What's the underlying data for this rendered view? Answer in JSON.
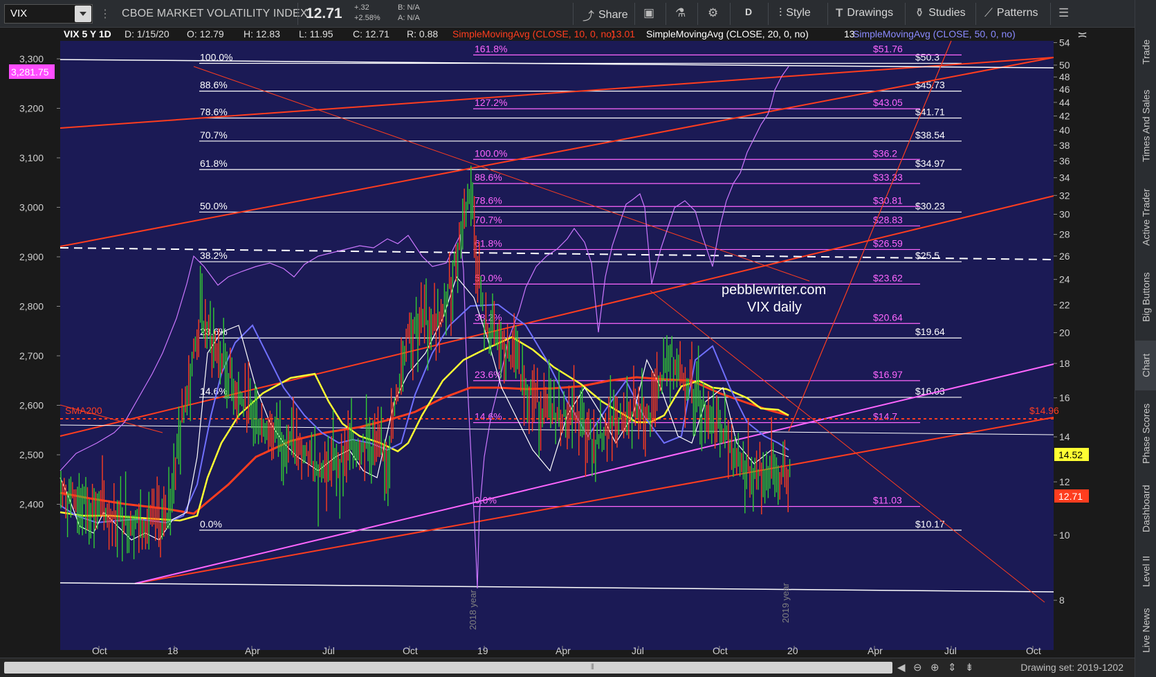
{
  "toolbar": {
    "symbol": "VIX",
    "description": "CBOE MARKET VOLATILITY INDEX",
    "last": "12.71",
    "change": "+.32",
    "change_pct": "+2.58%",
    "bid": "B: N/A",
    "ask": "A: N/A",
    "share_label": "Share",
    "aggregation_label": "D",
    "style_label": "Style",
    "drawings_label": "Drawings",
    "studies_label": "Studies",
    "patterns_label": "Patterns"
  },
  "right_sidebar": {
    "tabs": [
      "Trade",
      "Times And Sales",
      "Active Trader",
      "Big Buttons",
      "Chart",
      "Phase Scores",
      "Dashboard",
      "Level II",
      "Live News"
    ],
    "active": "Chart"
  },
  "chart_header": {
    "title": "VIX 5 Y 1D",
    "date": "D: 1/15/20",
    "open": "O: 12.79",
    "high": "H: 12.83",
    "low": "L: 11.95",
    "close": "C: 12.71",
    "range": "R: 0.88",
    "sma10_label": "SimpleMovingAvg (CLOSE, 10, 0, no)",
    "sma10_value": "13.01",
    "sma20_label": "SimpleMovingAvg (CLOSE, 20, 0, no)",
    "sma20_value": "13",
    "sma50_label": "SimpleMovingAvg (CLOSE, 50, 0, no)"
  },
  "left_axis": {
    "labels": [
      "3,300",
      "3,200",
      "3,100",
      "3,000",
      "2,900",
      "2,800",
      "2,700",
      "2,600",
      "2,500",
      "2,400"
    ],
    "highlight": "3,281.75"
  },
  "right_axis": {
    "labels": [
      "54",
      "50",
      "48",
      "46",
      "44",
      "42",
      "40",
      "38",
      "36",
      "34",
      "32",
      "30",
      "28",
      "26",
      "24",
      "22",
      "20",
      "18",
      "16",
      "14",
      "12",
      "10",
      "8"
    ],
    "tag_sma": "14.52",
    "tag_last": "12.71"
  },
  "x_axis": {
    "labels": [
      "Oct",
      "18",
      "Apr",
      "Jul",
      "Oct",
      "19",
      "Apr",
      "Jul",
      "Oct",
      "20",
      "Apr",
      "Jul",
      "Oct"
    ]
  },
  "fib_white": {
    "pct": [
      "100.0%",
      "88.6%",
      "78.6%",
      "70.7%",
      "61.8%",
      "50.0%",
      "38.2%",
      "23.6%",
      "14.6%",
      "0.0%"
    ],
    "values": [
      "$50.3",
      "$45.73",
      "$41.71",
      "$38.54",
      "$34.97",
      "$30.23",
      "$25.5",
      "$19.64",
      "$16.03",
      "$10.17"
    ]
  },
  "fib_pink": {
    "pct": [
      "161.8%",
      "127.2%",
      "100.0%",
      "88.6%",
      "78.6%",
      "70.7%",
      "61.8%",
      "50.0%",
      "38.2%",
      "23.6%",
      "14.6%",
      "0.0%"
    ],
    "values": [
      "$51.76",
      "$43.05",
      "$36.2",
      "$33.33",
      "$30.81",
      "$28.83",
      "$26.59",
      "$23.62",
      "$20.64",
      "$16.97",
      "$14.7",
      "$11.03"
    ]
  },
  "annotations": {
    "sma200": "SMA200",
    "sma200_value": "$14.96",
    "watermark_line1": "pebblewriter.com",
    "watermark_line2": "VIX daily",
    "year_2018": "2018 year",
    "year_2019": "2019 year"
  },
  "footer": {
    "drawing_set": "Drawing set: 2019-1202"
  },
  "colors": {
    "background": "#1b1a55",
    "fib_white": "#ffffff",
    "fib_pink": "#ff66ff",
    "trend_red": "#ff3d1f",
    "sma_yellow": "#ffff33",
    "sma_blue": "#7070ff",
    "spx_violet": "#cc77ff"
  }
}
